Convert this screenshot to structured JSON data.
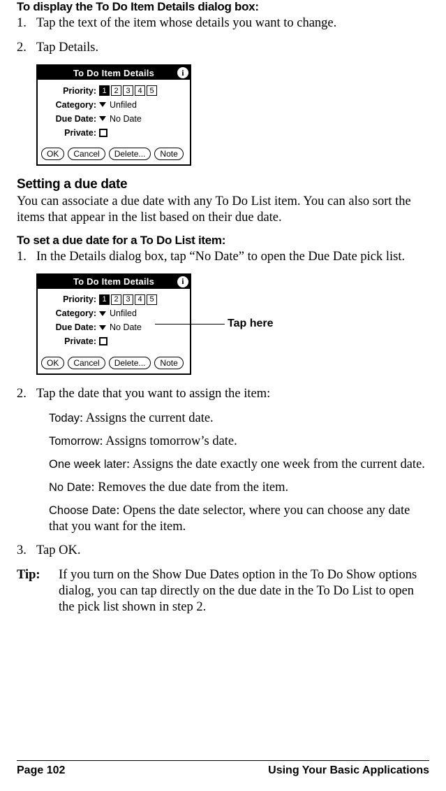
{
  "section1": {
    "heading": "To display the To Do Item Details dialog box:",
    "steps": [
      "Tap the text of the item whose details you want to change.",
      "Tap Details."
    ]
  },
  "dialog": {
    "title": "To Do Item Details",
    "info_glyph": "i",
    "labels": {
      "priority": "Priority:",
      "category": "Category:",
      "due_date": "Due Date:",
      "private": "Private:"
    },
    "priority_values": [
      "1",
      "2",
      "3",
      "4",
      "5"
    ],
    "priority_selected_index": 0,
    "category_value": "Unfiled",
    "due_date_value": "No Date",
    "buttons": {
      "ok": "OK",
      "cancel": "Cancel",
      "delete": "Delete...",
      "note": "Note"
    }
  },
  "section2": {
    "heading": "Setting a due date",
    "intro": "You can associate a due date with any To Do List item. You can also sort the items that appear in the list based on their due date."
  },
  "section3": {
    "heading": "To set a due date for a To Do List item:",
    "step1": "In the Details dialog box, tap “No Date” to open the Due Date pick list.",
    "callout": "Tap here",
    "step2_intro": "Tap the date that you want to assign the item:",
    "options": [
      {
        "label": "Today",
        "text": ": Assigns the current date."
      },
      {
        "label": "Tomorrow",
        "text": ": Assigns tomorrow’s date."
      },
      {
        "label": "One week later",
        "text": ": Assigns the date exactly one week from the cur­rent date."
      },
      {
        "label": "No Date",
        "text": ": Removes the due date from the item."
      },
      {
        "label": "Choose Date",
        "text": ": Opens the date selector, where you can choose any date that you want for the item."
      }
    ],
    "step3": "Tap OK."
  },
  "tip": {
    "label": "Tip:",
    "text": "If you turn on the Show Due Dates option in the To Do Show options dialog, you can tap directly on the due date in the To Do List to open the pick list shown in step 2."
  },
  "footer": {
    "left": "Page 102",
    "right": "Using Your Basic Applications"
  }
}
